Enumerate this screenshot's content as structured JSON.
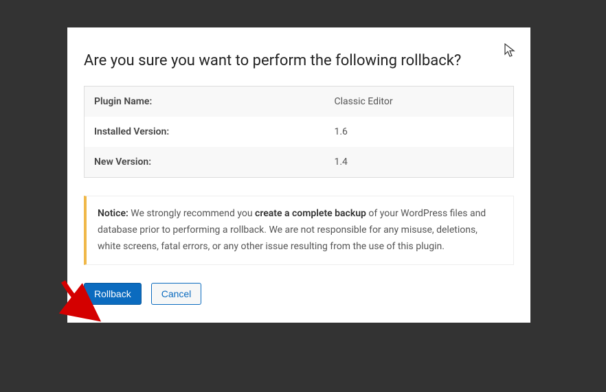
{
  "dialog": {
    "title": "Are you sure you want to perform the following rollback?",
    "rows": [
      {
        "label": "Plugin Name:",
        "value": "Classic Editor"
      },
      {
        "label": "Installed Version:",
        "value": "1.6"
      },
      {
        "label": "New Version:",
        "value": "1.4"
      }
    ],
    "notice": {
      "prefix": "Notice:",
      "part1": " We strongly recommend you ",
      "strong": "create a complete backup",
      "part2": " of your WordPress files and database prior to performing a rollback. We are not responsible for any misuse, deletions, white screens, fatal errors, or any other issue resulting from the use of this plugin."
    },
    "actions": {
      "primary": "Rollback",
      "secondary": "Cancel"
    }
  }
}
